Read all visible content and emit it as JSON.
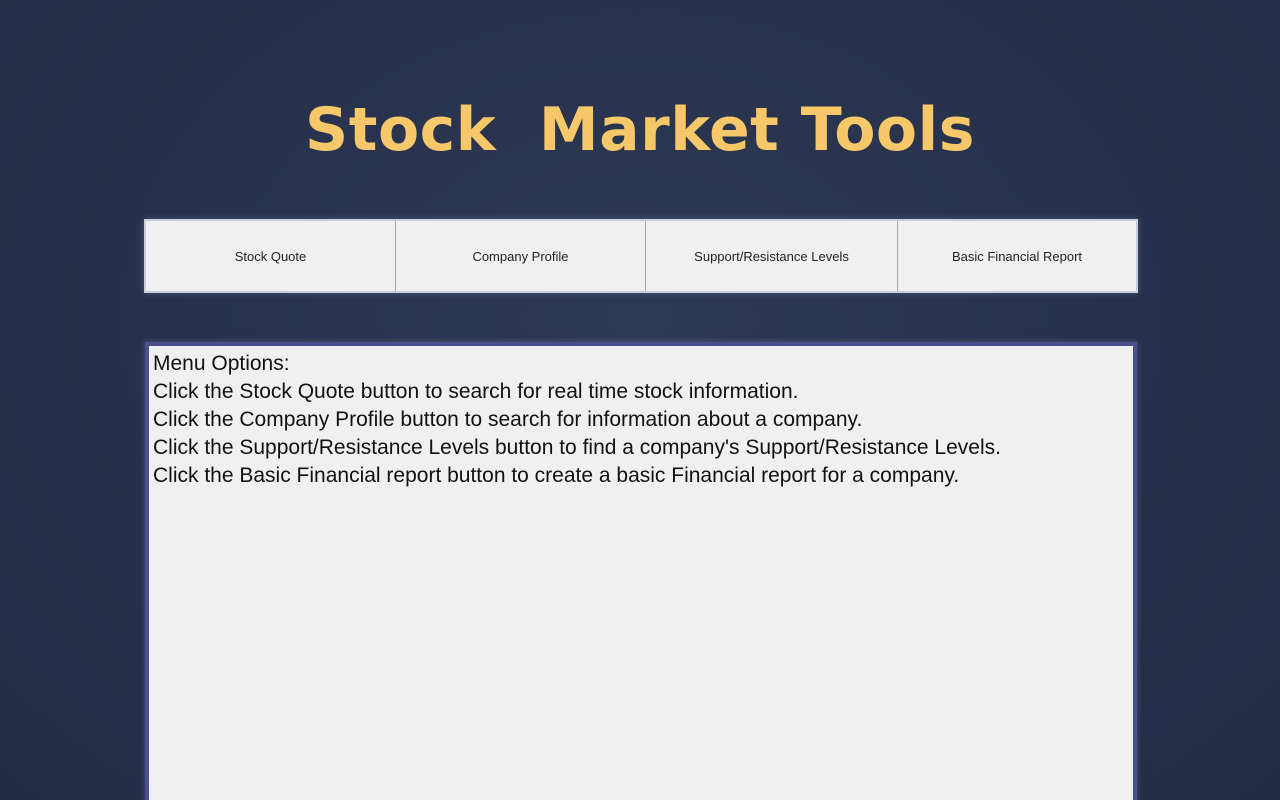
{
  "app": {
    "title": "Stock  Market Tools"
  },
  "nav": {
    "buttons": [
      {
        "label": "Stock Quote"
      },
      {
        "label": "Company Profile"
      },
      {
        "label": "Support/Resistance Levels"
      },
      {
        "label": "Basic Financial Report"
      }
    ]
  },
  "output": {
    "lines": [
      "Menu Options:",
      "Click the Stock Quote button to search for real time stock information.",
      "Click the Company Profile button to search for information about a company.",
      "Click the Support/Resistance Levels button to find a company's Support/Resistance Levels.",
      "Click the Basic Financial report button to create a basic Financial report for a company."
    ]
  },
  "colors": {
    "background": "#27314b",
    "title": "#f7c869",
    "panel": "#f0f0f0",
    "panel_border": "#4b4f8f"
  }
}
